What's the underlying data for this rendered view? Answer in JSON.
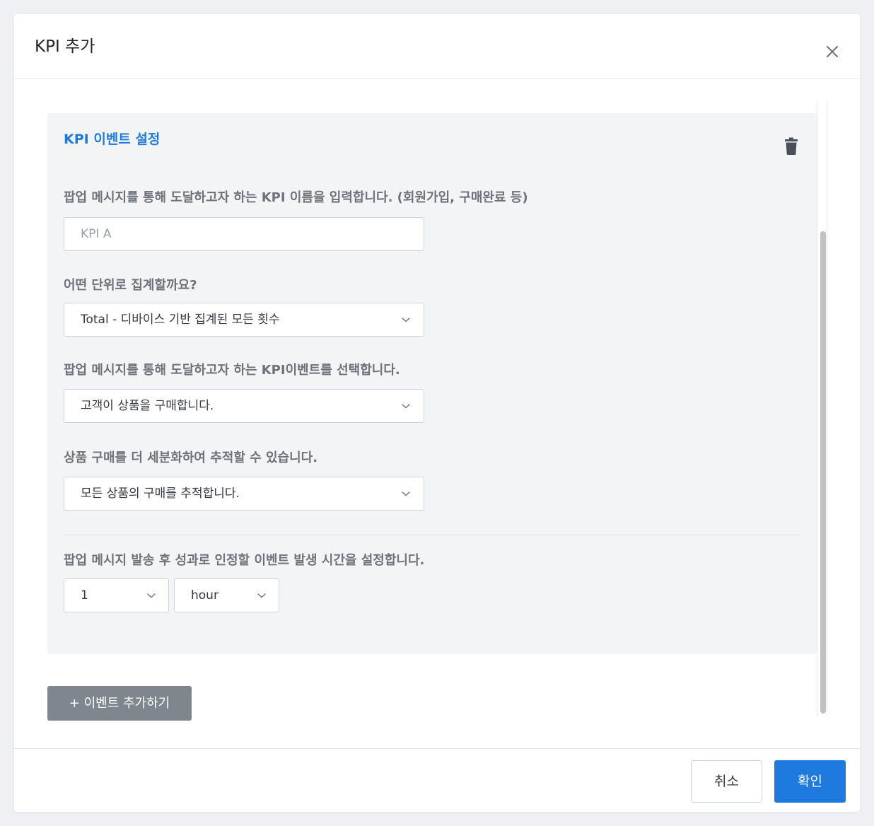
{
  "modal": {
    "title": "KPI 추가"
  },
  "card": {
    "title": "KPI 이벤트 설정",
    "kpi_name": {
      "label": "팝업 메시지를 통해 도달하고자 하는 KPI 이름을 입력합니다. (회원가입, 구매완료 등)",
      "placeholder": "KPI A",
      "value": ""
    },
    "aggregation": {
      "label": "어떤 단위로 집계할까요?",
      "selected": "Total - 디바이스 기반 집계된 모든 횟수"
    },
    "kpi_event": {
      "label": "팝업 메시지를 통해 도달하고자 하는 KPI이벤트를 선택합니다.",
      "selected": "고객이 상품을 구매합니다."
    },
    "product_filter": {
      "label": "상품 구매를 더 세분화하여 추적할 수 있습니다.",
      "selected": "모든 상품의 구매를 추적합니다."
    },
    "attribution_window": {
      "label": "팝업 메시지 발송 후 성과로 인정할 이벤트 발생 시간을 설정합니다.",
      "amount": "1",
      "unit": "hour"
    }
  },
  "add_event_label": "+ 이벤트 추가하기",
  "footer": {
    "cancel_label": "취소",
    "confirm_label": "확인"
  },
  "icons": {
    "close": "close-icon",
    "trash": "trash-icon",
    "chevron": "chevron-down-icon"
  },
  "colors": {
    "accent": "#1f7ae0",
    "card_background": "#f3f4f6",
    "secondary_button": "#7f868d",
    "label_text": "#6d737a"
  }
}
